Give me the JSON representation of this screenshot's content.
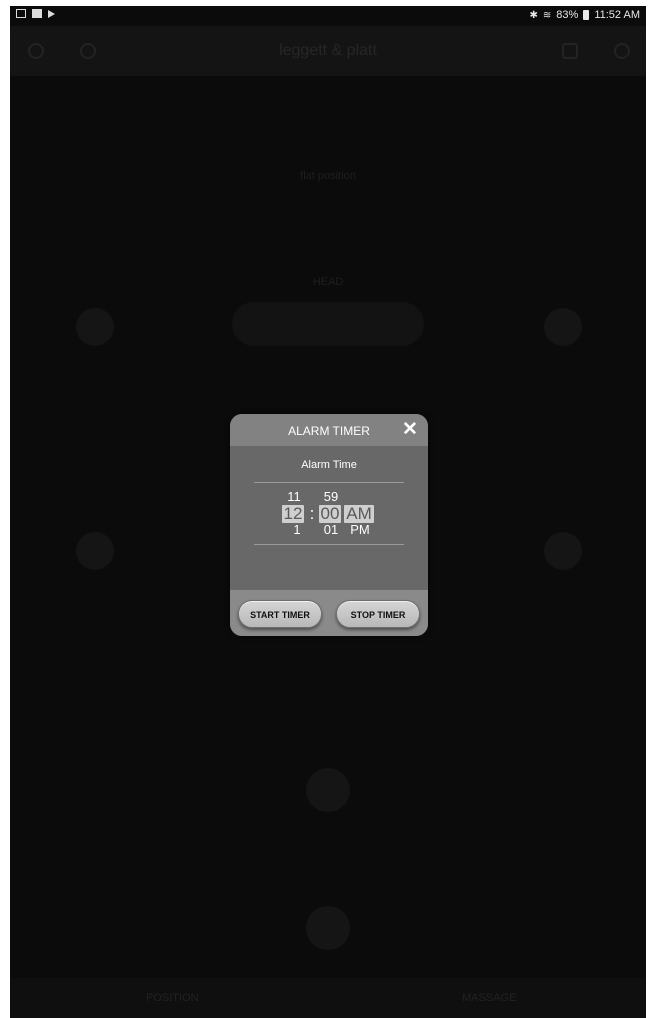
{
  "status_bar": {
    "battery": "83%",
    "time": "11:52 AM"
  },
  "background_app": {
    "title": "leggett & platt",
    "head_label": "HEAD",
    "flat_label": "flat position",
    "tabs": {
      "position": "POSITION",
      "massage": "MASSAGE"
    }
  },
  "dialog": {
    "title": "ALARM TIMER",
    "close_icon": "close-icon",
    "subtitle": "Alarm Time",
    "picker": {
      "hour_above": "11",
      "minute_above": "59",
      "hour_selected": "12",
      "separator": ":",
      "minute_selected": "00",
      "ampm_selected": "AM",
      "hour_below": "1",
      "minute_below": "01",
      "ampm_below": "PM"
    },
    "start_button": "START TIMER",
    "stop_button": "STOP TIMER"
  },
  "colors": {
    "overlay": "#0b0b0b",
    "dialog_body": "#686868",
    "dialog_header": "#828282",
    "highlight": "#cfcfcf"
  }
}
